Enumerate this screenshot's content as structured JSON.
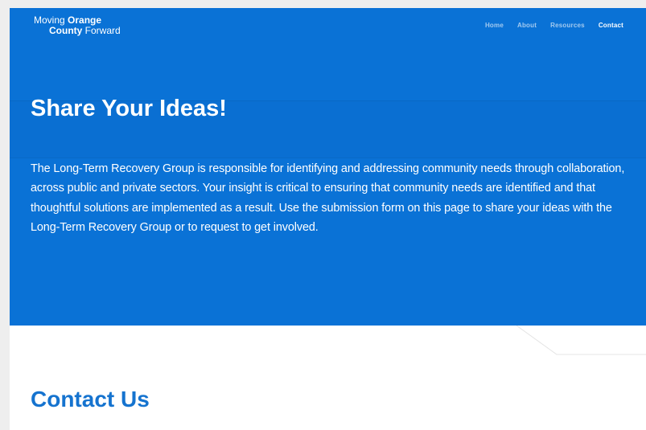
{
  "logo": {
    "line1_regular": "Moving ",
    "line1_bold": "Orange",
    "line2_bold": "County",
    "line2_regular": " Forward"
  },
  "nav": {
    "items": [
      {
        "label": "Home",
        "active": false
      },
      {
        "label": "About",
        "active": false
      },
      {
        "label": "Resources",
        "active": false
      },
      {
        "label": "Contact",
        "active": true
      }
    ]
  },
  "hero": {
    "title": "Share Your Ideas!",
    "body": "The Long-Term Recovery Group is responsible for identifying and addressing community needs through collaboration, across public and private sectors. Your insight is critical to ensuring that community needs are identified and that thoughtful solutions are implemented as a result. Use the submission form on this page to share your ideas with the Long-Term Recovery Group or to request to get involved."
  },
  "contact": {
    "title": "Contact Us"
  },
  "colors": {
    "hero_background": "#0a72d6",
    "heading_blue": "#1573cf",
    "text_white": "#ffffff"
  }
}
